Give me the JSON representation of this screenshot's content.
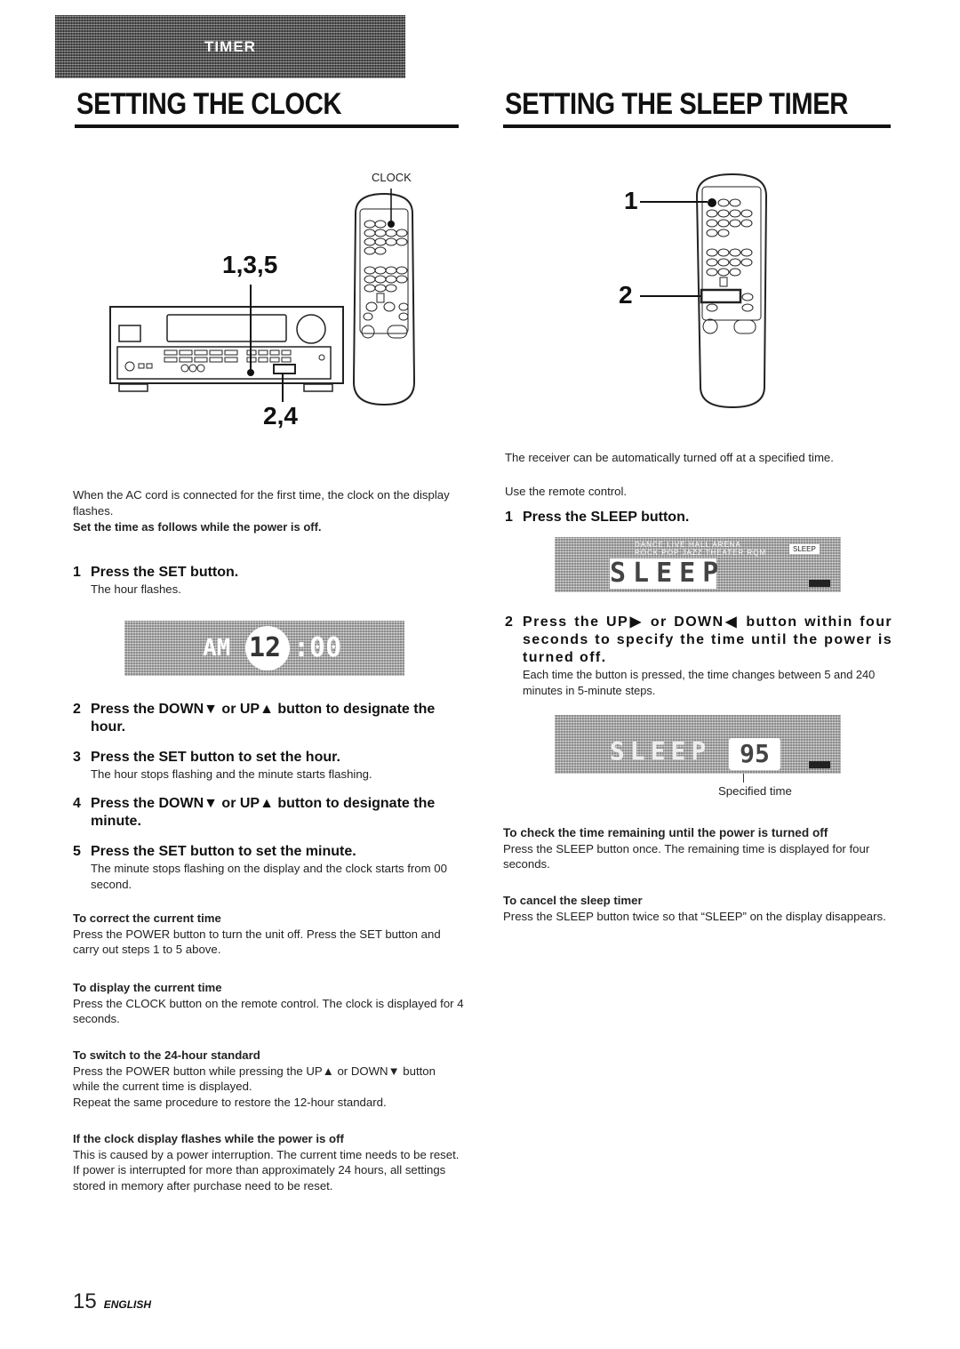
{
  "banner": {
    "label": "TIMER"
  },
  "clock": {
    "title": "SETTING THE CLOCK",
    "figure": {
      "clock_label": "CLOCK",
      "callout_top": "1,3,5",
      "callout_bottom": "2,4"
    },
    "intro": "When the AC cord is connected for the first time, the clock on the display flashes.",
    "intro_bold": "Set the time as follows while the power is off.",
    "steps": [
      {
        "num": "1",
        "title": "Press the SET button.",
        "desc": "The hour flashes."
      },
      {
        "num": "2",
        "title": "Press the DOWN▼ or UP▲ button to designate the hour.",
        "desc": ""
      },
      {
        "num": "3",
        "title": "Press the SET button to set the hour.",
        "desc": "The hour stops flashing and the minute starts flashing."
      },
      {
        "num": "4",
        "title": "Press the DOWN▼ or UP▲ button to designate the minute.",
        "desc": ""
      },
      {
        "num": "5",
        "title": "Press the SET button to set the minute.",
        "desc": "The minute stops flashing on the display and the clock starts from 00 second."
      }
    ],
    "display": {
      "prefix": "AM",
      "hour": "12",
      "minute": ":00"
    },
    "notes": [
      {
        "title": "To correct the current time",
        "body": [
          "Press the POWER button to turn the unit off. Press the SET button and carry out steps 1 to 5 above."
        ]
      },
      {
        "title": "To display the current time",
        "body": [
          "Press the CLOCK button on the remote control. The clock is displayed for 4 seconds."
        ]
      },
      {
        "title": "To switch to the 24-hour standard",
        "body": [
          "Press the POWER button while pressing the UP▲ or DOWN▼ button while the current time is displayed.",
          "Repeat the same procedure to restore the 12-hour standard."
        ]
      },
      {
        "title": "If the clock display flashes while the power is off",
        "body": [
          "This is caused by a power interruption. The current time needs to be reset.",
          "If power is interrupted for more than approximately 24 hours, all settings stored in memory after purchase need to be reset."
        ]
      }
    ]
  },
  "sleep": {
    "title": "SETTING THE SLEEP TIMER",
    "figure": {
      "callout_1": "1",
      "callout_2": "2"
    },
    "intro": "The receiver can be automatically turned off at a specified time.",
    "use_remote": "Use the remote control.",
    "step1": {
      "num": "1",
      "title": "Press the SLEEP button."
    },
    "display1": {
      "text": "SLEEP",
      "indicator": "SLEEP",
      "modes_top": [
        "DANCE",
        "LIVE",
        "HALL",
        "ARENA"
      ],
      "modes_bottom": [
        "ROCK",
        "POP",
        "JAZZ",
        "THEATER",
        "RQM"
      ]
    },
    "step2": {
      "num": "2",
      "title": "Press the UP▶ or DOWN◀ button within four seconds to specify the time until the power is turned off.",
      "desc": "Each time the button is pressed, the time changes between 5 and 240 minutes in 5-minute steps."
    },
    "display2": {
      "text": "SLEEP",
      "value": "95",
      "caption": "Specified time"
    },
    "notes": [
      {
        "title": "To check the time remaining until the power is turned off",
        "body": "Press the SLEEP button once. The remaining time is displayed for four seconds."
      },
      {
        "title": "To cancel the sleep timer",
        "body": "Press the SLEEP button twice so that “SLEEP” on the display disappears."
      }
    ]
  },
  "footer": {
    "page": "15",
    "language": "ENGLISH"
  }
}
